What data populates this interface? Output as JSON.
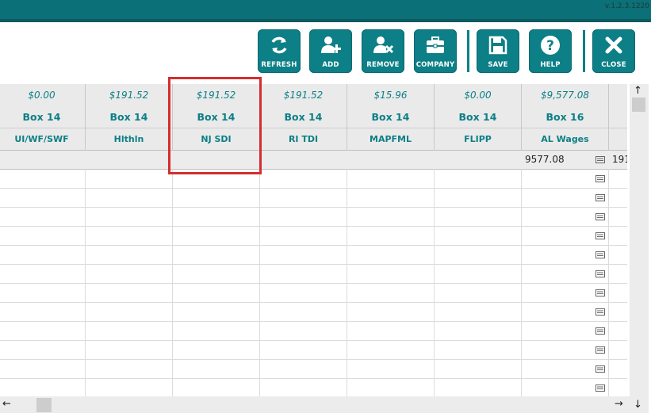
{
  "app": {
    "version": "v.1.2.3.1220"
  },
  "toolbar": {
    "refresh_label": "REFRESH",
    "add_label": "ADD",
    "remove_label": "REMOVE",
    "company_label": "COMPANY",
    "save_label": "SAVE",
    "help_label": "HELP",
    "close_label": "CLOSE"
  },
  "columns": [
    {
      "amount": "$0.00",
      "box": "Box 14",
      "name": "UI/WF/SWF"
    },
    {
      "amount": "$191.52",
      "box": "Box 14",
      "name": "Hlthln"
    },
    {
      "amount": "$191.52",
      "box": "Box 14",
      "name": "NJ SDI"
    },
    {
      "amount": "$191.52",
      "box": "Box 14",
      "name": "RI TDI"
    },
    {
      "amount": "$15.96",
      "box": "Box 14",
      "name": "MAPFML"
    },
    {
      "amount": "$0.00",
      "box": "Box 14",
      "name": "FLIPP"
    },
    {
      "amount": "$9,577.08",
      "box": "Box 16",
      "name": "AL Wages"
    }
  ],
  "total_row": {
    "al_wages": "9577.08",
    "next_partial": "191"
  },
  "colors": {
    "accent": "#0d7f86",
    "topbar": "#0b7077",
    "highlight": "#d42e2e"
  },
  "icons": [
    "refresh-icon",
    "add-user-icon",
    "remove-user-icon",
    "briefcase-icon",
    "floppy-icon",
    "help-icon",
    "close-icon",
    "list-icon"
  ]
}
